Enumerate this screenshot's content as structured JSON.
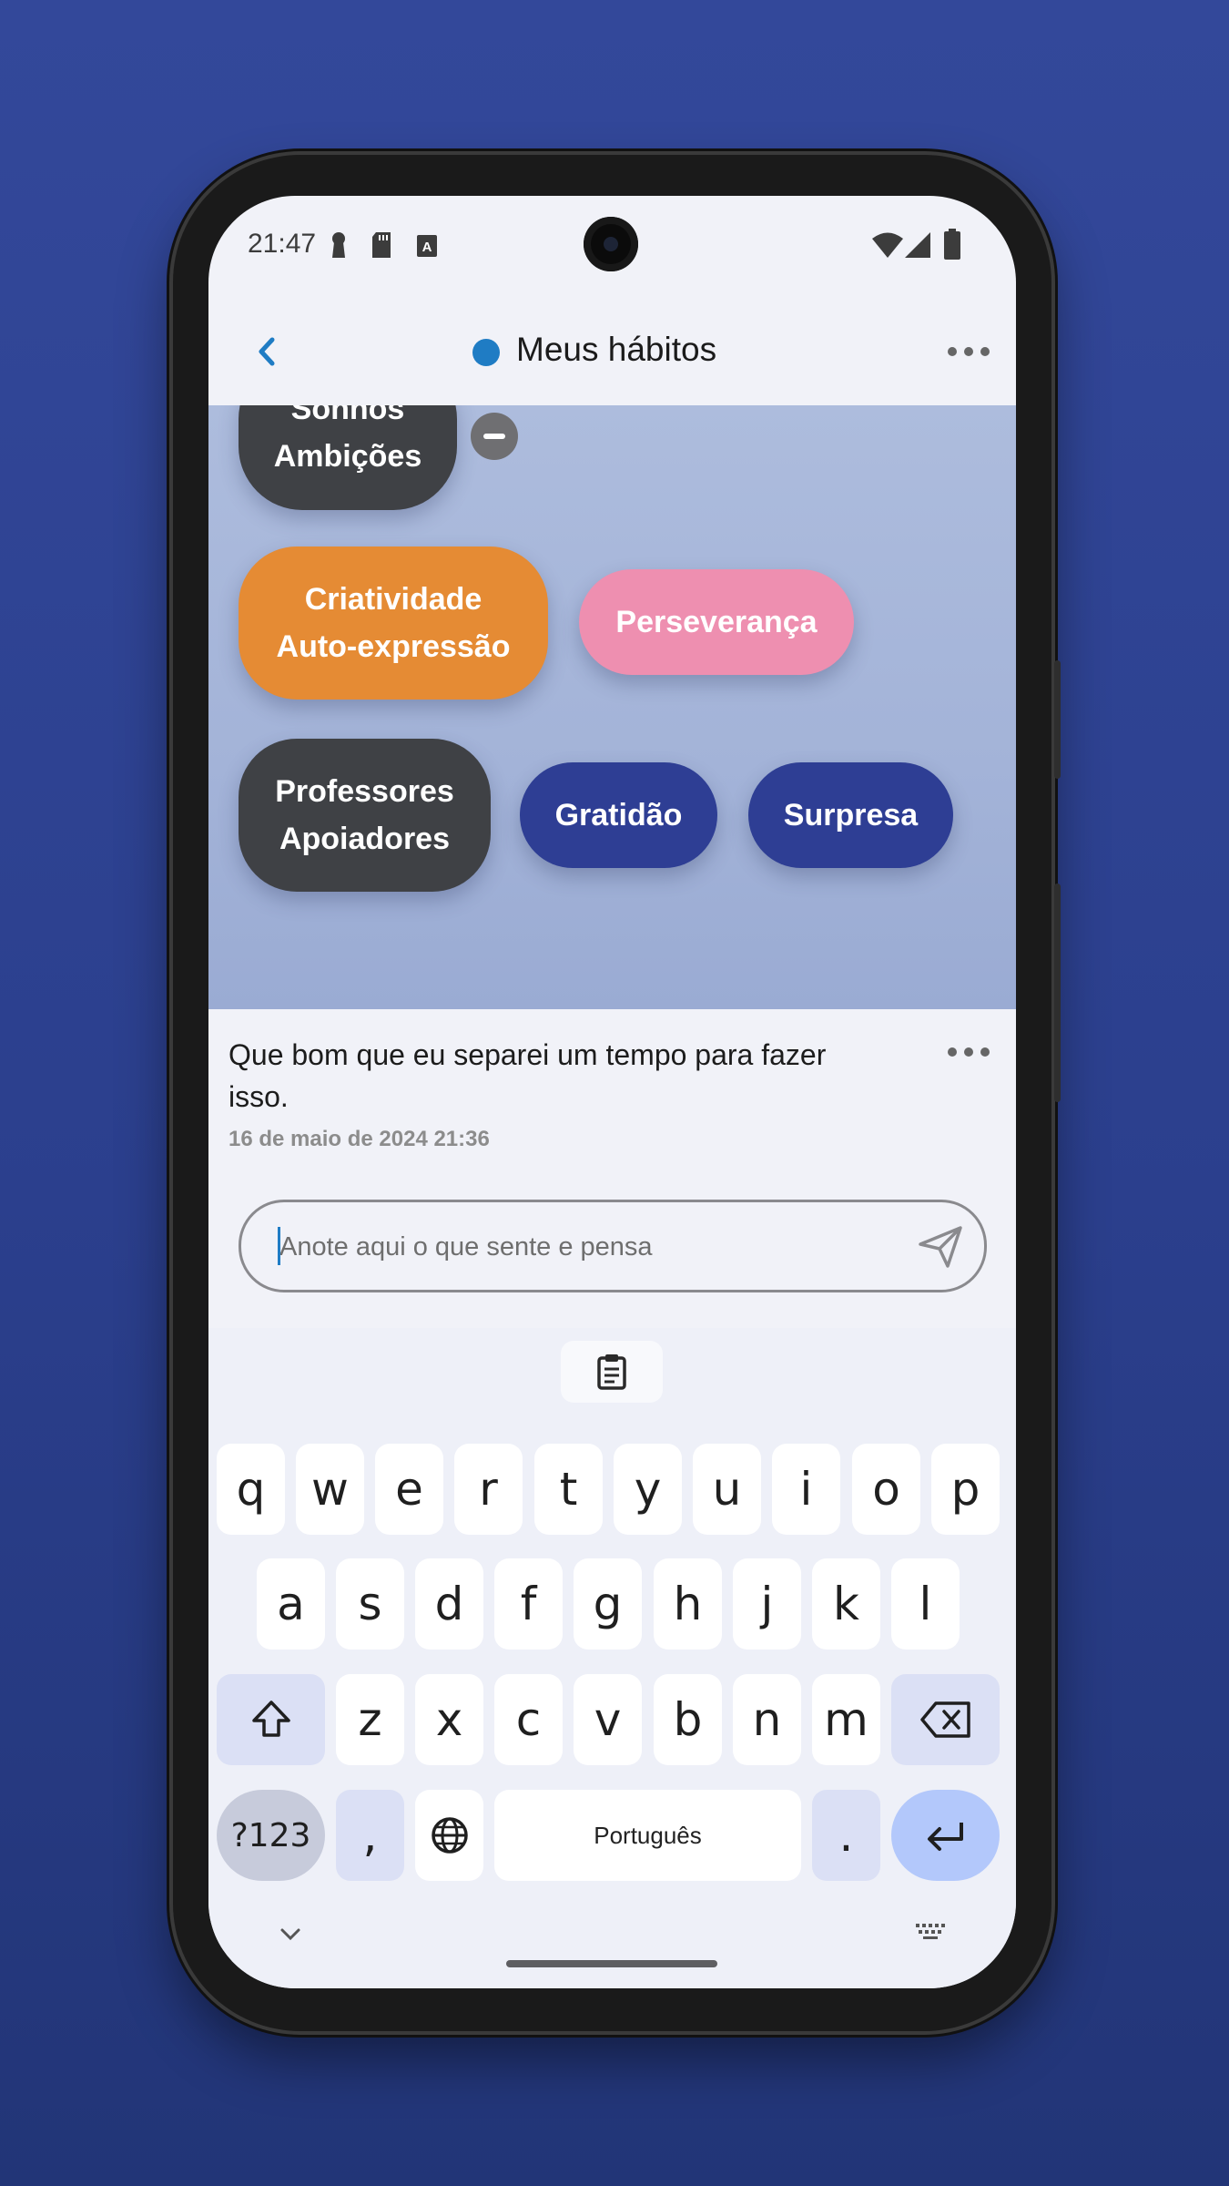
{
  "status_bar": {
    "time": "21:47"
  },
  "header": {
    "title": "Meus hábitos",
    "dot_color": "#1f7cc4"
  },
  "bubbles": [
    {
      "label": "Sonhos\nAmbições",
      "color": "#3f4145"
    },
    {
      "label": "Criatividade\nAuto-expressão",
      "color": "#e58b34"
    },
    {
      "label": "Perseverança",
      "color": "#ee8fb0"
    },
    {
      "label": "Professores\nApoiadores",
      "color": "#3f4145"
    },
    {
      "label": "Gratidão",
      "color": "#2e3e94"
    },
    {
      "label": "Surpresa",
      "color": "#2e3e94"
    }
  ],
  "note": {
    "text": "Que bom que eu separei um tempo para fazer isso.",
    "date": "16 de maio de 2024 21:36"
  },
  "input": {
    "placeholder": "Anote aqui o que sente e pensa",
    "value": ""
  },
  "keyboard": {
    "row1": [
      "q",
      "w",
      "e",
      "r",
      "t",
      "y",
      "u",
      "i",
      "o",
      "p"
    ],
    "row2": [
      "a",
      "s",
      "d",
      "f",
      "g",
      "h",
      "j",
      "k",
      "l"
    ],
    "row3": [
      "z",
      "x",
      "c",
      "v",
      "b",
      "n",
      "m"
    ],
    "symbols_key": "?123",
    "comma_key": ",",
    "space_key": "Português",
    "period_key": "."
  }
}
